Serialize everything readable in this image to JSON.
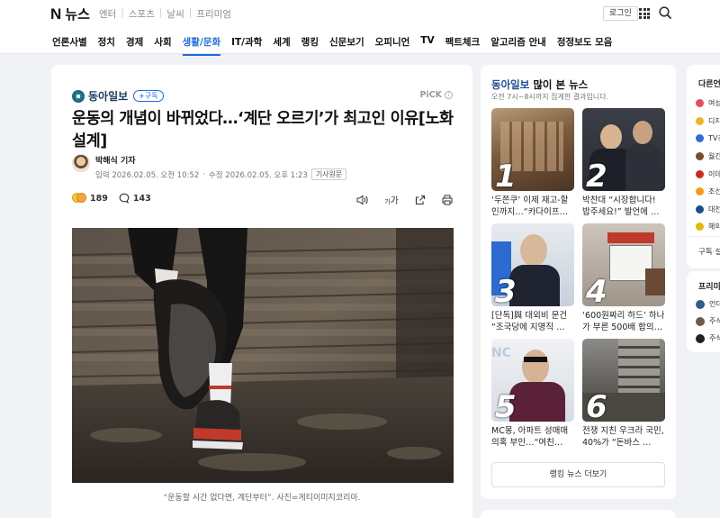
{
  "header": {
    "logo_letter": "N",
    "logo_text": "뉴스",
    "service_links": [
      "엔터",
      "스포츠",
      "날씨",
      "프리미엄"
    ],
    "login_label": "로그인"
  },
  "nav": {
    "items": [
      "언론사별",
      "정치",
      "경제",
      "사회",
      "생활/문화",
      "IT/과학",
      "세계",
      "랭킹",
      "신문보기",
      "오피니언",
      "TV",
      "팩트체크",
      "알고리즘 안내",
      "정정보도 모음"
    ],
    "active": "생활/문화"
  },
  "article": {
    "press_name": "동아일보",
    "subscribe_label": "+구독",
    "pick_label": "PiCK",
    "headline": "운동의 개념이 바뀌었다…‘계단 오르기’가 최고인 이유[노화설계]",
    "author": "박해식 기자",
    "date_input": "입력 2026.02.05. 오전 10:52",
    "date_modified": "수정 2026.02.05. 오후 1:23",
    "original_label": "기사원문",
    "reaction_count": "189",
    "comment_count": "143",
    "font_tool_label": "가",
    "caption": "“운동할 시간 없다면, 계단부터”. 사진=게티이미지코리아."
  },
  "popular": {
    "press": "동아일보",
    "title_suffix": " 많이 본 뉴스",
    "subtitle": "오전 7시~8시까지 집계한 결과입니다.",
    "items": [
      {
        "rank": "1",
        "text": "‘두쫀쿠’ 이제 재고-할인까지…“카다이프…"
      },
      {
        "rank": "2",
        "text": "박찬대 “시장합니다! 밥주세요!” 발언에 …"
      },
      {
        "rank": "3",
        "text": "[단독]與 대외비 문건 “조국당에 지명직 …"
      },
      {
        "rank": "4",
        "text": "‘600원짜리 하드’ 하나가 부른 500배 합의…"
      },
      {
        "rank": "5",
        "text": "MC몽, 아파트 성매매 의혹 부인…“여친…"
      },
      {
        "rank": "6",
        "text": "전쟁 지친 우크라 국민, 40%가 “돈바스 …"
      }
    ],
    "more_label": "랭킹 뉴스 더보기"
  },
  "edge_panel": {
    "title": "다른언론",
    "items": [
      "여성",
      "디지",
      "TV조",
      "월간",
      "이데",
      "조선",
      "대전",
      "해외"
    ],
    "subscribe_text": "구독 설",
    "premium_title": "프리미엄",
    "premium_items": [
      "언더",
      "주식",
      "주식"
    ]
  },
  "colors": {
    "accent": "#1f6be0",
    "press_blue": "#1f4e94",
    "page_bg": "#f0f2f5"
  }
}
